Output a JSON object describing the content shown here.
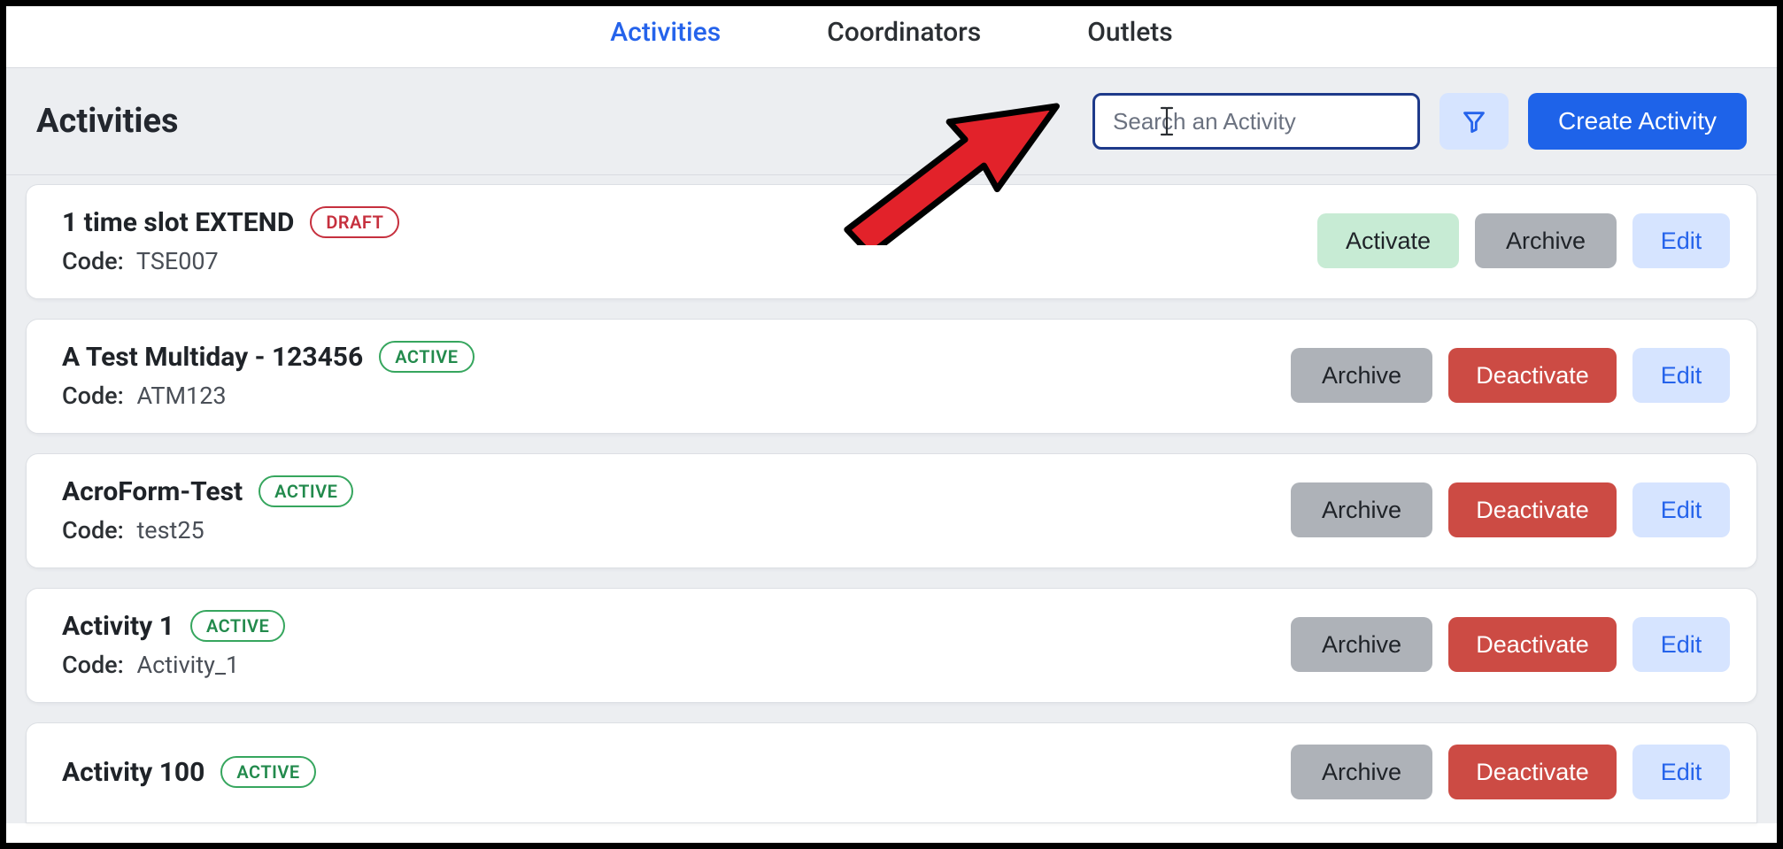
{
  "nav": {
    "tabs": [
      {
        "label": "Activities",
        "active": true
      },
      {
        "label": "Coordinators",
        "active": false
      },
      {
        "label": "Outlets",
        "active": false
      }
    ]
  },
  "header": {
    "title": "Activities",
    "search_placeholder": "Search an Activity",
    "search_value": "",
    "create_label": "Create Activity"
  },
  "status_labels": {
    "draft": "DRAFT",
    "active": "ACTIVE"
  },
  "button_labels": {
    "activate": "Activate",
    "archive": "Archive",
    "deactivate": "Deactivate",
    "edit": "Edit"
  },
  "code_prefix": "Code:",
  "activities": [
    {
      "title": "1 time slot EXTEND",
      "status": "draft",
      "code": "TSE007",
      "actions": [
        "activate",
        "archive",
        "edit"
      ]
    },
    {
      "title": "A Test Multiday - 123456",
      "status": "active",
      "code": "ATM123",
      "actions": [
        "archive",
        "deactivate",
        "edit"
      ]
    },
    {
      "title": "AcroForm-Test",
      "status": "active",
      "code": "test25",
      "actions": [
        "archive",
        "deactivate",
        "edit"
      ]
    },
    {
      "title": "Activity 1",
      "status": "active",
      "code": "Activity_1",
      "actions": [
        "archive",
        "deactivate",
        "edit"
      ]
    },
    {
      "title": "Activity 100",
      "status": "active",
      "code": "",
      "actions": [
        "archive",
        "deactivate",
        "edit"
      ]
    }
  ],
  "annotation": {
    "arrow_points_to": "search-input"
  }
}
